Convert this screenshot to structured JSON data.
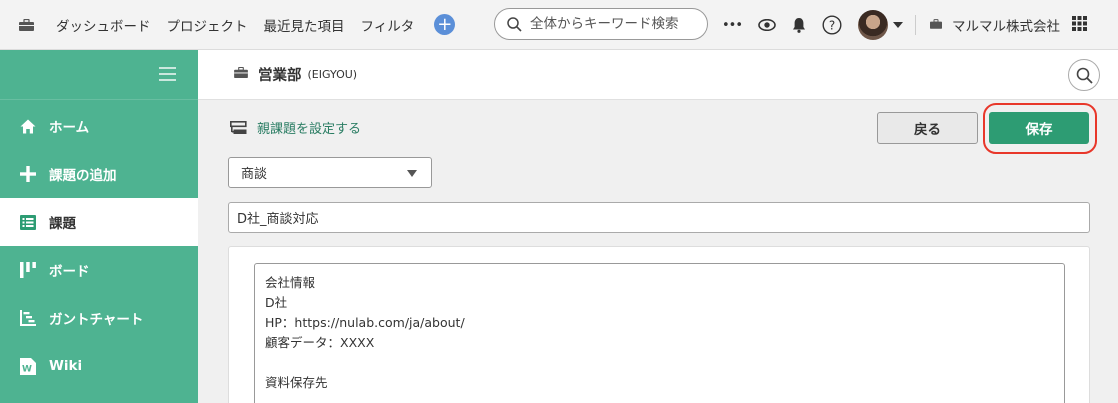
{
  "topbar": {
    "nav": [
      "ダッシュボード",
      "プロジェクト",
      "最近見た項目",
      "フィルタ"
    ],
    "search_placeholder": "全体からキーワード検索",
    "more_label": "•••",
    "company": "マルマル株式会社"
  },
  "sidebar": {
    "items": [
      {
        "label": "ホーム",
        "icon": "home-icon",
        "active": false
      },
      {
        "label": "課題の追加",
        "icon": "plus-icon",
        "active": false
      },
      {
        "label": "課題",
        "icon": "list-icon",
        "active": true
      },
      {
        "label": "ボード",
        "icon": "board-icon",
        "active": false
      },
      {
        "label": "ガントチャート",
        "icon": "gantt-icon",
        "active": false
      },
      {
        "label": "Wiki",
        "icon": "wiki-icon",
        "active": false
      }
    ]
  },
  "project": {
    "name": "営業部",
    "key": "(EIGYOU)"
  },
  "form": {
    "parent_link": "親課題を設定する",
    "back_label": "戻る",
    "save_label": "保存",
    "issue_type": "商談",
    "subject": "D社_商談対応",
    "description_lines": [
      "会社情報",
      "D社",
      "HP：https://nulab.com/ja/about/",
      "顧客データ：XXXX",
      "",
      "資料保存先"
    ]
  },
  "colors": {
    "accent_green": "#4eb391",
    "save_button": "#2d9c73",
    "highlight_red": "#e8372a",
    "add_button_blue": "#5b8fd8"
  }
}
